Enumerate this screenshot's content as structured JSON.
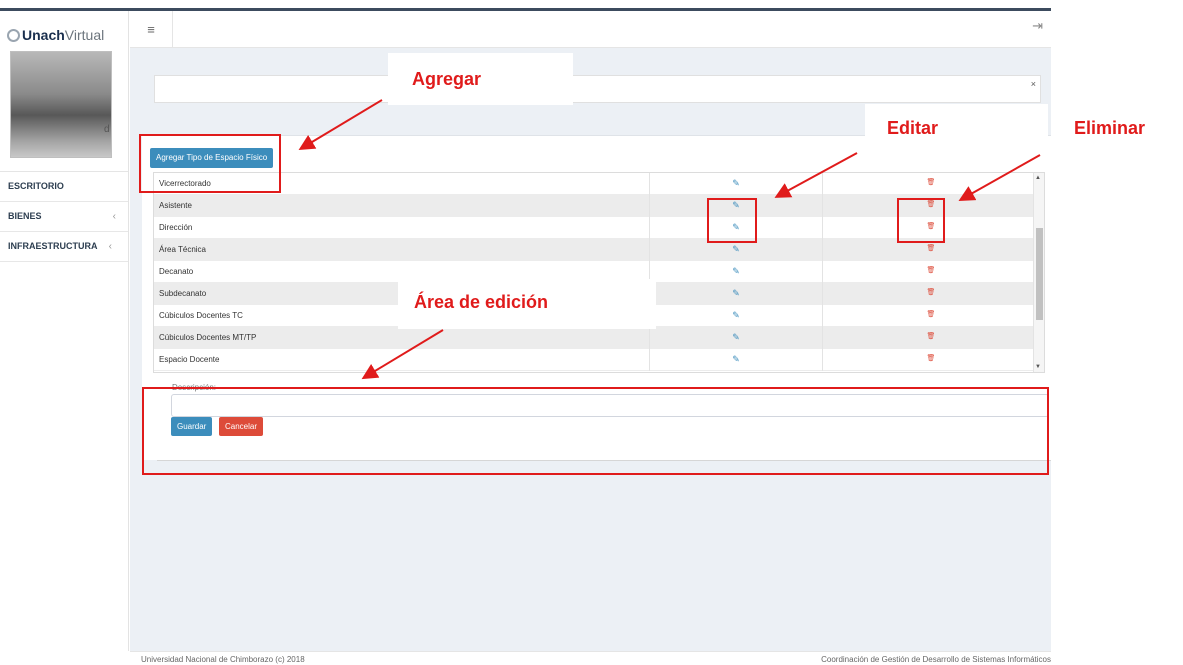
{
  "app": {
    "logo_bold": "Unach",
    "logo_light": "Virtual",
    "user_suffix": "d"
  },
  "sidebar": {
    "items": [
      {
        "label": "ESCRITORIO",
        "chevron": ""
      },
      {
        "label": "BIENES",
        "chevron": "‹"
      },
      {
        "label": "INFRAESTRUCTURA",
        "chevron": "‹"
      }
    ]
  },
  "header": {
    "menu_icon": "≡",
    "logout_icon": "⇥"
  },
  "top_box": {
    "close": "×"
  },
  "toolbar": {
    "add_label": "Agregar Tipo de Espacio Físico"
  },
  "grid": {
    "rows": [
      {
        "descripcion": "Vicerrectorado"
      },
      {
        "descripcion": "Asistente"
      },
      {
        "descripcion": "Dirección"
      },
      {
        "descripcion": "Área Técnica"
      },
      {
        "descripcion": "Decanato"
      },
      {
        "descripcion": "Subdecanato"
      },
      {
        "descripcion": "Cúbiculos Docentes TC"
      },
      {
        "descripcion": "Cúbiculos Docentes MT/TP"
      },
      {
        "descripcion": "Espacio Docente"
      }
    ],
    "edit_icon": "✎",
    "delete_icon": "🗑"
  },
  "form": {
    "description_label": "Descripción:",
    "description_value": "",
    "save_label": "Guardar",
    "cancel_label": "Cancelar"
  },
  "footer": {
    "left": "Universidad Nacional de Chimborazo (c) 2018",
    "right": "Coordinación de Gestión de Desarrollo de Sistemas Informáticos"
  },
  "annotations": {
    "agregar": "Agregar",
    "editar": "Editar",
    "eliminar": "Eliminar",
    "area_edicion": "Área de edición"
  },
  "colors": {
    "primary": "#3c8dbc",
    "danger": "#dd4b39",
    "annotation": "#e01b1b",
    "sidebar_text": "#2d3e50"
  }
}
